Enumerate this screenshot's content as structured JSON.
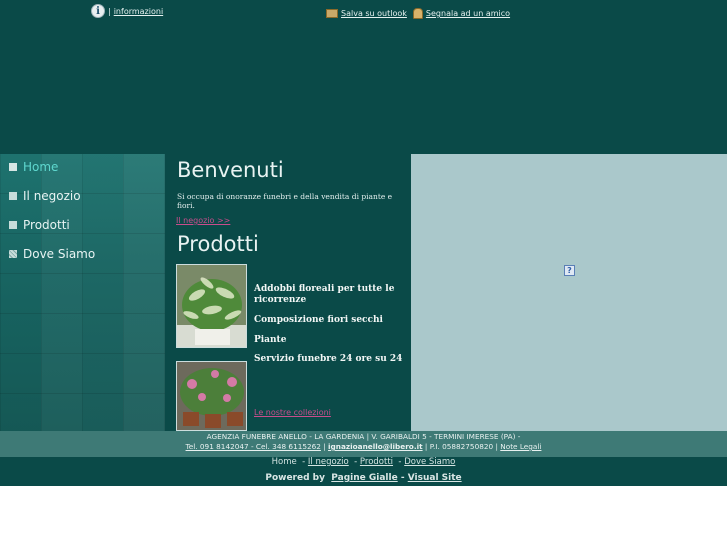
{
  "topbar": {
    "info_link": "informazioni",
    "separator": "|",
    "save_outlook": "Salva su outlook",
    "tell_friend": "Segnala ad un amico"
  },
  "nav": {
    "items": [
      {
        "label": "Home",
        "active": true
      },
      {
        "label": "Il negozio",
        "active": false
      },
      {
        "label": "Prodotti",
        "active": false
      },
      {
        "label": "Dove Siamo",
        "active": false
      }
    ]
  },
  "main": {
    "welcome_title": "Benvenuti",
    "intro": "Si occupa di onoranze funebri e della vendita di piante e fiori.",
    "negozio_link": "Il negozio >>",
    "products_title": "Prodotti",
    "products": [
      "Addobbi floreali per tutte le ricorrenze",
      "Composizione fiori secchi",
      "Piante",
      "Servizio funebre 24 ore su 24"
    ],
    "collections_link": "Le nostre collezioni"
  },
  "footer": {
    "company": "AGENZIA FUNEBRE ANELLO - LA GARDENIA | V. GARIBALDI 5 - TERMINI IMERESE (PA) -",
    "phones": "Tel. 091 8142047 - Cel. 348 6115262",
    "email": "ignazioanello@libero.it",
    "vat": "P.I. 05882750820",
    "legal": "Note Legali",
    "nav": [
      "Home",
      "Il negozio",
      "Prodotti",
      "Dove Siamo"
    ],
    "powered_by": "Powered by",
    "pagine_gialle": "Pagine Gialle",
    "dash": "-",
    "visual_site": "Visual Site"
  },
  "colors": {
    "background": "#0a4a48",
    "accent_link": "#c84d8c",
    "active_nav": "#5fd8cf",
    "map": "#aac8cb"
  }
}
